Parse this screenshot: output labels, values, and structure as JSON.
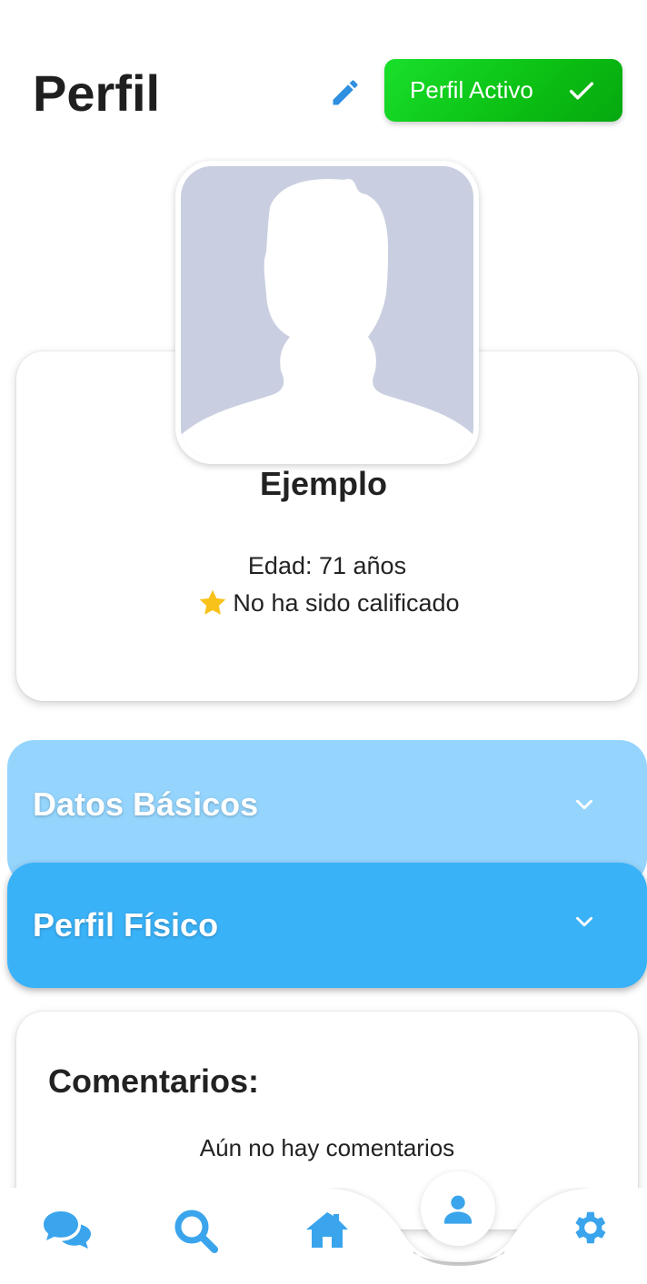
{
  "header": {
    "title": "Perfil",
    "status_button_label": "Perfil Activo"
  },
  "profile": {
    "name": "Ejemplo",
    "age_text": "Edad: 71 años",
    "rating_text": "No ha sido calificado"
  },
  "sections": [
    {
      "label": "Datos Básicos"
    },
    {
      "label": "Perfil Físico"
    }
  ],
  "comments": {
    "title": "Comentarios:",
    "empty_text": "Aún no hay comentarios"
  },
  "bottom_nav": {
    "items": [
      "chat-icon",
      "search-icon",
      "home-icon",
      "profile-icon",
      "settings-icon"
    ],
    "active": "profile-icon"
  },
  "colors": {
    "accent": "#3ab2f8",
    "accent_light": "#95d5fd",
    "active_green": "#0bbf13",
    "avatar_placeholder": "#c9cfe0",
    "star": "#f9c21a"
  }
}
